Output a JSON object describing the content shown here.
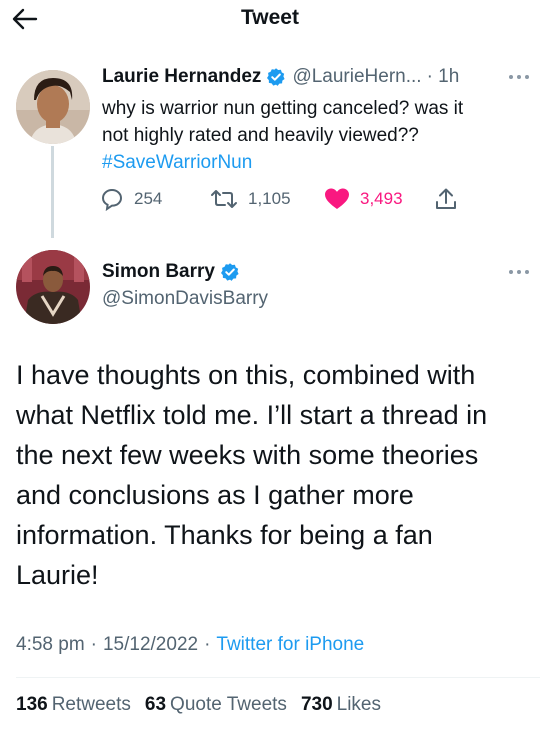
{
  "header": {
    "title": "Tweet",
    "back_icon": "arrow-left-icon"
  },
  "reply_tweet": {
    "author_name": "Laurie Hernandez",
    "author_handle": "@LaurieHern...",
    "time": "· 1h",
    "text_line1": "why is warrior nun getting canceled? was it",
    "text_line2": "not highly rated and heavily viewed??",
    "hashtag": "#SaveWarriorNun",
    "actions": {
      "replies": "254",
      "retweets": "1,105",
      "likes": "3,493"
    }
  },
  "main_tweet": {
    "author_name": "Simon Barry",
    "author_handle": "@SimonDavisBarry",
    "text": "I have thoughts on this, combined with what Netflix told me. I’ll start a thread in the next few weeks with some theories and conclusions as I gather more information. Thanks for being a fan Laurie!",
    "time": "4:58 pm",
    "date": "15/12/2022",
    "source": "Twitter for iPhone",
    "stats": {
      "retweets_count": "136",
      "retweets_label": "Retweets",
      "quotes_count": "63",
      "quotes_label": "Quote Tweets",
      "likes_count": "730",
      "likes_label": "Likes"
    }
  },
  "colors": {
    "accent": "#1d9bf0",
    "like": "#f91880",
    "secondary_text": "#536471",
    "verified": "#1d9bf0"
  }
}
